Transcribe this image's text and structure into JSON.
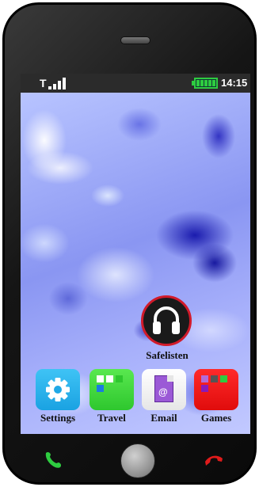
{
  "status_bar": {
    "signal_label": "T",
    "time": "14:15"
  },
  "featured_app": {
    "label": "Safelisten",
    "icon": "headphones-icon"
  },
  "dock": {
    "apps": [
      {
        "label": "Settings",
        "icon": "gear-icon",
        "color": "#1aa2e2"
      },
      {
        "label": "Travel",
        "icon": "grid-icon",
        "color": "#2ec72e"
      },
      {
        "label": "Email",
        "icon": "email-document-icon",
        "color": "#ffffff"
      },
      {
        "label": "Games",
        "icon": "grid-icon",
        "color": "#e00c0c"
      }
    ]
  },
  "buttons": {
    "call": {
      "icon": "phone-answer-icon",
      "color": "#2ecc40"
    },
    "home": {
      "icon": "home-button"
    },
    "end_call": {
      "icon": "phone-hangup-icon",
      "color": "#e01b1b"
    }
  },
  "email_icon_glyph": "@"
}
